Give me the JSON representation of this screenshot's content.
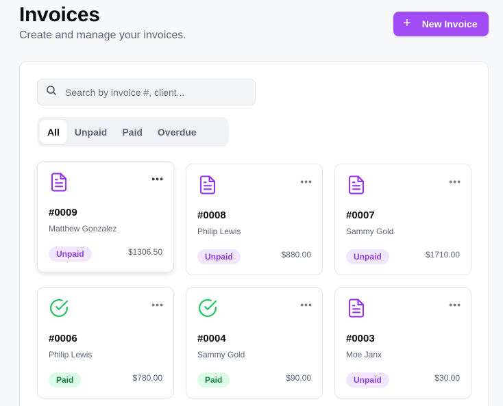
{
  "header": {
    "title": "Invoices",
    "subtitle": "Create and manage your invoices.",
    "new_button_label": "New Invoice"
  },
  "search": {
    "placeholder": "Search by invoice #, client...",
    "value": ""
  },
  "tabs": [
    {
      "label": "All",
      "active": true
    },
    {
      "label": "Unpaid",
      "active": false
    },
    {
      "label": "Paid",
      "active": false
    },
    {
      "label": "Overdue",
      "active": false
    }
  ],
  "colors": {
    "accent": "#a24cf6",
    "unpaid_bg": "#f2e6fd",
    "unpaid_text": "#8a3fd8",
    "paid_bg": "#dcfce7",
    "paid_text": "#15803d",
    "paid_icon": "#22c55e",
    "doc_icon": "#9333ea"
  },
  "invoices": [
    {
      "number": "#0009",
      "client": "Matthew Gonzalez",
      "status": "Unpaid",
      "amount": "$1306.50",
      "icon": "document-icon"
    },
    {
      "number": "#0008",
      "client": "Philip Lewis",
      "status": "Unpaid",
      "amount": "$880.00",
      "icon": "document-icon"
    },
    {
      "number": "#0007",
      "client": "Sammy Gold",
      "status": "Unpaid",
      "amount": "$1710.00",
      "icon": "document-icon"
    },
    {
      "number": "#0006",
      "client": "Philip Lewis",
      "status": "Paid",
      "amount": "$780.00",
      "icon": "check-circle-icon"
    },
    {
      "number": "#0004",
      "client": "Sammy Gold",
      "status": "Paid",
      "amount": "$90.00",
      "icon": "check-circle-icon"
    },
    {
      "number": "#0003",
      "client": "Moe Janx",
      "status": "Unpaid",
      "amount": "$30.00",
      "icon": "document-icon"
    }
  ]
}
